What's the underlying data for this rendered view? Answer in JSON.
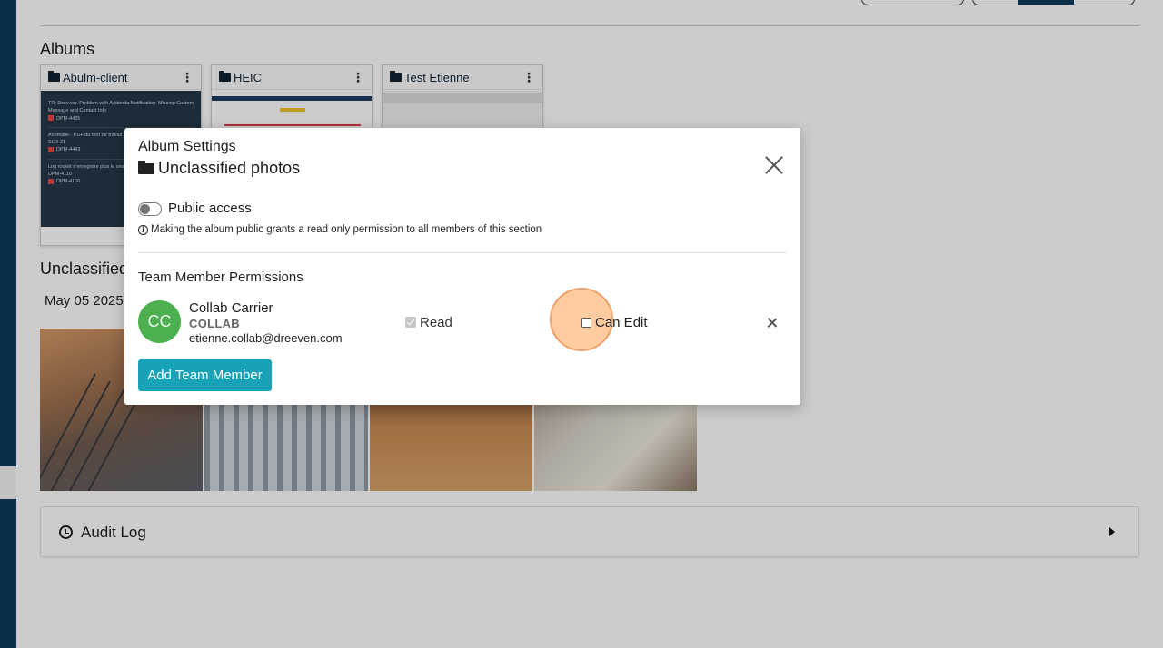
{
  "albums_section": {
    "title": "Albums",
    "albums": [
      {
        "name": "Abulm-client",
        "kebab": "⋮",
        "preview_rows": [
          {
            "text": "TR: Dreeven: Problem with Addenda Notification: Missing Custom Message and Contact Info",
            "tag": "DPM-4435"
          },
          {
            "text": "Anomalie - PDF du bon de travail",
            "sub": "SO3-21",
            "tag": "DPM-4443"
          },
          {
            "text": "Log rocket n'enregistre plus le session n'est pas bien enregistré",
            "sub": "DPM-4110",
            "tag": "DPM-4166"
          }
        ]
      },
      {
        "name": "HEIC",
        "kebab": "⋮"
      },
      {
        "name": "Test Etienne",
        "kebab": "⋮"
      }
    ]
  },
  "unclassified_section": {
    "title": "Unclassified",
    "date": "May 05 2025"
  },
  "audit_log": {
    "label": "Audit Log"
  },
  "modal": {
    "title": "Album Settings",
    "album_name": "Unclassified photos",
    "public_access_label": "Public access",
    "public_access_enabled": false,
    "info_text": "Making the album public grants a read only permission to all members of this section",
    "permissions_title": "Team Member Permissions",
    "members": [
      {
        "initials": "CC",
        "name": "Collab Carrier",
        "role": "COLLAB",
        "email": "etienne.collab@dreeven.com",
        "read_label": "Read",
        "read_checked": true,
        "edit_label": "Can Edit",
        "edit_checked": false
      }
    ],
    "add_button": "Add Team Member"
  },
  "colors": {
    "navy": "#0c3c5a",
    "teal": "#17a2b8",
    "avatar_green": "#4caf50",
    "highlight": "#ffbb82"
  }
}
